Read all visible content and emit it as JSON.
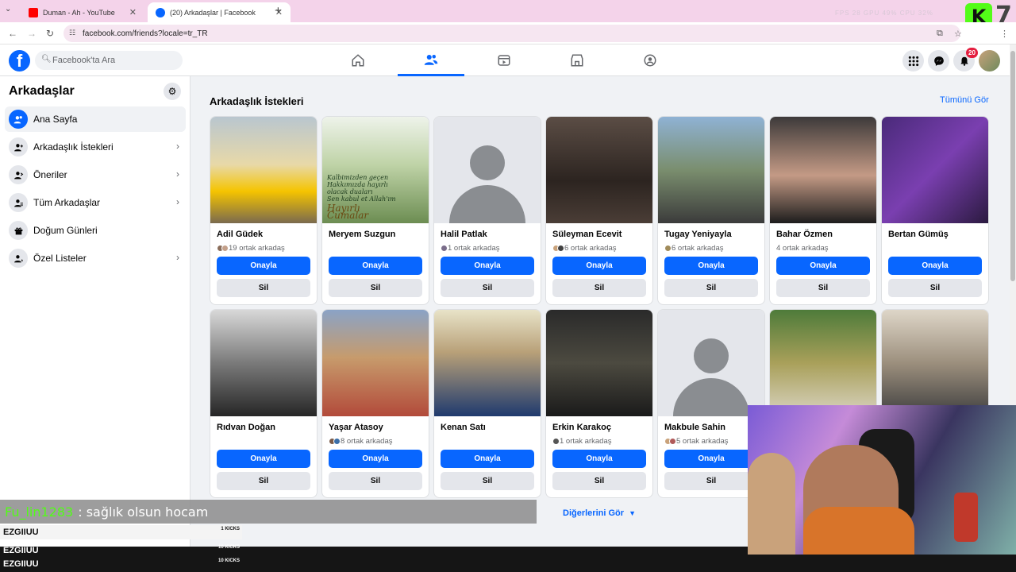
{
  "browser": {
    "tabs": [
      {
        "title": "Duman - Ah - YouTube",
        "active": false
      },
      {
        "title": "(20) Arkadaşlar | Facebook",
        "active": true
      }
    ],
    "url": "facebook.com/friends?locale=tr_TR"
  },
  "stream_overlay": {
    "stats": "FPS 28   GPU 49%   CPU 32%",
    "logo_letter": "K",
    "corner_number": "7",
    "chat": {
      "user": "Fu_lin1283",
      "message": ": sağlık olsun hocam"
    },
    "kicks": [
      {
        "name": "EZGIIUU",
        "count": "1 KICKS"
      },
      {
        "name": "EZGIIUU",
        "count": "10 KICKS"
      },
      {
        "name": "EZGIIUU",
        "count": "10 KICKS"
      }
    ]
  },
  "facebook": {
    "search_placeholder": "Facebook'ta Ara",
    "notification_count": "20",
    "sidebar": {
      "title": "Arkadaşlar",
      "items": [
        {
          "label": "Ana Sayfa",
          "icon": "friends-icon",
          "active": true
        },
        {
          "label": "Arkadaşlık İstekleri",
          "icon": "friend-request-icon",
          "chevron": true
        },
        {
          "label": "Öneriler",
          "icon": "suggestion-icon",
          "chevron": true
        },
        {
          "label": "Tüm Arkadaşlar",
          "icon": "all-friends-icon",
          "chevron": true
        },
        {
          "label": "Doğum Günleri",
          "icon": "gift-icon"
        },
        {
          "label": "Özel Listeler",
          "icon": "custom-list-icon",
          "chevron": true
        }
      ]
    },
    "section": {
      "title": "Arkadaşlık İstekleri",
      "see_all": "Tümünü Gör",
      "confirm_label": "Onayla",
      "delete_label": "Sil",
      "see_more": "Diğerlerini Gör"
    },
    "requests": [
      {
        "name": "Adil Güdek",
        "mutual": "19 ortak arkadaş"
      },
      {
        "name": "Meryem Suzgun",
        "mutual": "",
        "photo_text": [
          "Kalbimizden geçen",
          "Hakkımızda hayırlı",
          "olacak duaları",
          "Sen kabul et Allah'ım",
          "Hayırlı Cumalar"
        ]
      },
      {
        "name": "Halil Patlak",
        "mutual": "1 ortak arkadaş"
      },
      {
        "name": "Süleyman Ecevit",
        "mutual": "6 ortak arkadaş"
      },
      {
        "name": "Tugay Yeniyayla",
        "mutual": "6 ortak arkadaş"
      },
      {
        "name": "Bahar Özmen",
        "mutual": "4 ortak arkadaş"
      },
      {
        "name": "Bertan Gümüş",
        "mutual": ""
      },
      {
        "name": "Rıdvan Doğan",
        "mutual": ""
      },
      {
        "name": "Yaşar Atasoy",
        "mutual": "8 ortak arkadaş"
      },
      {
        "name": "Kenan Satı",
        "mutual": ""
      },
      {
        "name": "Erkin Karakoç",
        "mutual": "1 ortak arkadaş"
      },
      {
        "name": "Makbule Sahin",
        "mutual": "5 ortak arkadaş"
      },
      {
        "name": "",
        "mutual": ""
      },
      {
        "name": "",
        "mutual": ""
      }
    ]
  }
}
